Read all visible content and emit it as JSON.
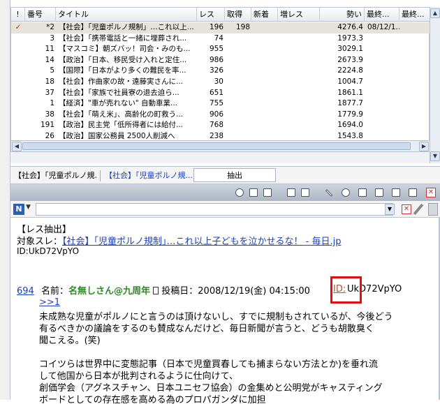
{
  "thread_table": {
    "headers": [
      "!",
      "番号",
      "タイトル",
      "レス",
      "取得",
      "新着",
      "増レス",
      "勢い",
      "最終...",
      "最終..."
    ],
    "rows": [
      {
        "mark": "✓",
        "num": "*2",
        "title": "【社会】「児童ポルノ規制」…これ以上...",
        "res": "196",
        "got": "198",
        "new": "",
        "inc": "",
        "ikioi": "4276.4",
        "last": "08/12/1...",
        "selected": true
      },
      {
        "mark": "",
        "num": "3",
        "title": "【社会】「携帯電話と一緒に埋葬され...",
        "res": "74",
        "got": "",
        "new": "",
        "inc": "",
        "ikioi": "1973.3",
        "last": ""
      },
      {
        "mark": "",
        "num": "11",
        "title": "【マスコミ】朝ズバッ！司会・みのも...",
        "res": "955",
        "got": "",
        "new": "",
        "inc": "",
        "ikioi": "3029.1",
        "last": ""
      },
      {
        "mark": "",
        "num": "14",
        "title": "【政治】「日本、移民受け入れと定住...",
        "res": "986",
        "got": "",
        "new": "",
        "inc": "",
        "ikioi": "2673.9",
        "last": ""
      },
      {
        "mark": "",
        "num": "5",
        "title": "【国際】「日本がより多くの難民を率...",
        "res": "326",
        "got": "",
        "new": "",
        "inc": "",
        "ikioi": "2224.8",
        "last": ""
      },
      {
        "mark": "",
        "num": "18",
        "title": "【社会】作曲家の故・遠藤実さんに...",
        "res": "30",
        "got": "",
        "new": "",
        "inc": "",
        "ikioi": "1004.7",
        "last": ""
      },
      {
        "mark": "",
        "num": "37",
        "title": "【社会】「家族で社員寮の退去迫ら...",
        "res": "651",
        "got": "",
        "new": "",
        "inc": "",
        "ikioi": "1861.1",
        "last": ""
      },
      {
        "mark": "",
        "num": "1",
        "title": "【経済】\"車が売れない\" 自動車業...",
        "res": "755",
        "got": "",
        "new": "",
        "inc": "",
        "ikioi": "1877.7",
        "last": ""
      },
      {
        "mark": "",
        "num": "38",
        "title": "【社会】「萌え米」、高齢化の町救う...",
        "res": "906",
        "got": "",
        "new": "",
        "inc": "",
        "ikioi": "1779.9",
        "last": ""
      },
      {
        "mark": "",
        "num": "191",
        "title": "【政治】民主党「低所得者には給付...",
        "res": "768",
        "got": "",
        "new": "",
        "inc": "",
        "ikioi": "1694.0",
        "last": ""
      },
      {
        "mark": "",
        "num": "26",
        "title": "【政治】国家公務員 2500人削減へ",
        "res": "238",
        "got": "",
        "new": "",
        "inc": "",
        "ikioi": "1543.8",
        "last": ""
      }
    ]
  },
  "tabs": {
    "tab1": "【社会】｢児童ポルノ規...",
    "tab2": "【社会】｢児童ポルノ規...",
    "extract": "抽出"
  },
  "address": {
    "value": ""
  },
  "content": {
    "header": "【レス抽出】",
    "target_label": "対象スレ：",
    "target_link": "【社会】｢児童ポルノ規制｣…これ以上子どもを泣かせるな！ - 毎日.jp",
    "id_line": "ID:UkD72VpYO",
    "post_num": "694",
    "name_label": "名前：",
    "name": "名無しさん@九周年",
    "post_date": "投稿日：2008/12/19(金) 04:15:00",
    "id_link": "ID:",
    "id_rest": "UkD72VpYO",
    "anchor": ">>1",
    "body_lines": [
      "未成熟な児童がポルノにと言うのは頂けないし、すでに規制もされているが、今後どう",
      "有るべきかの議論をするのも賛成なんだけど、毎日新聞が言うと、どうも胡散臭く",
      "聞こえる。(笑)",
      "",
      "コイツらは世界中に変態記事（日本で児童買春しても捕まらない方法とか)を垂れ流",
      "して他国から日本が批判されるように仕向けて、",
      "創価学会（アグネスチャン、日本ユニセフ協会）の金集めと公明党がキャスティング",
      "ボードとしての存在感を高める為のプロパガンダに加担"
    ]
  },
  "colors": {
    "name_green": "#2e8b23",
    "link_blue": "#1a3fb8",
    "highlight_red": "#e01010",
    "id_link_orange": "#c0502a"
  }
}
